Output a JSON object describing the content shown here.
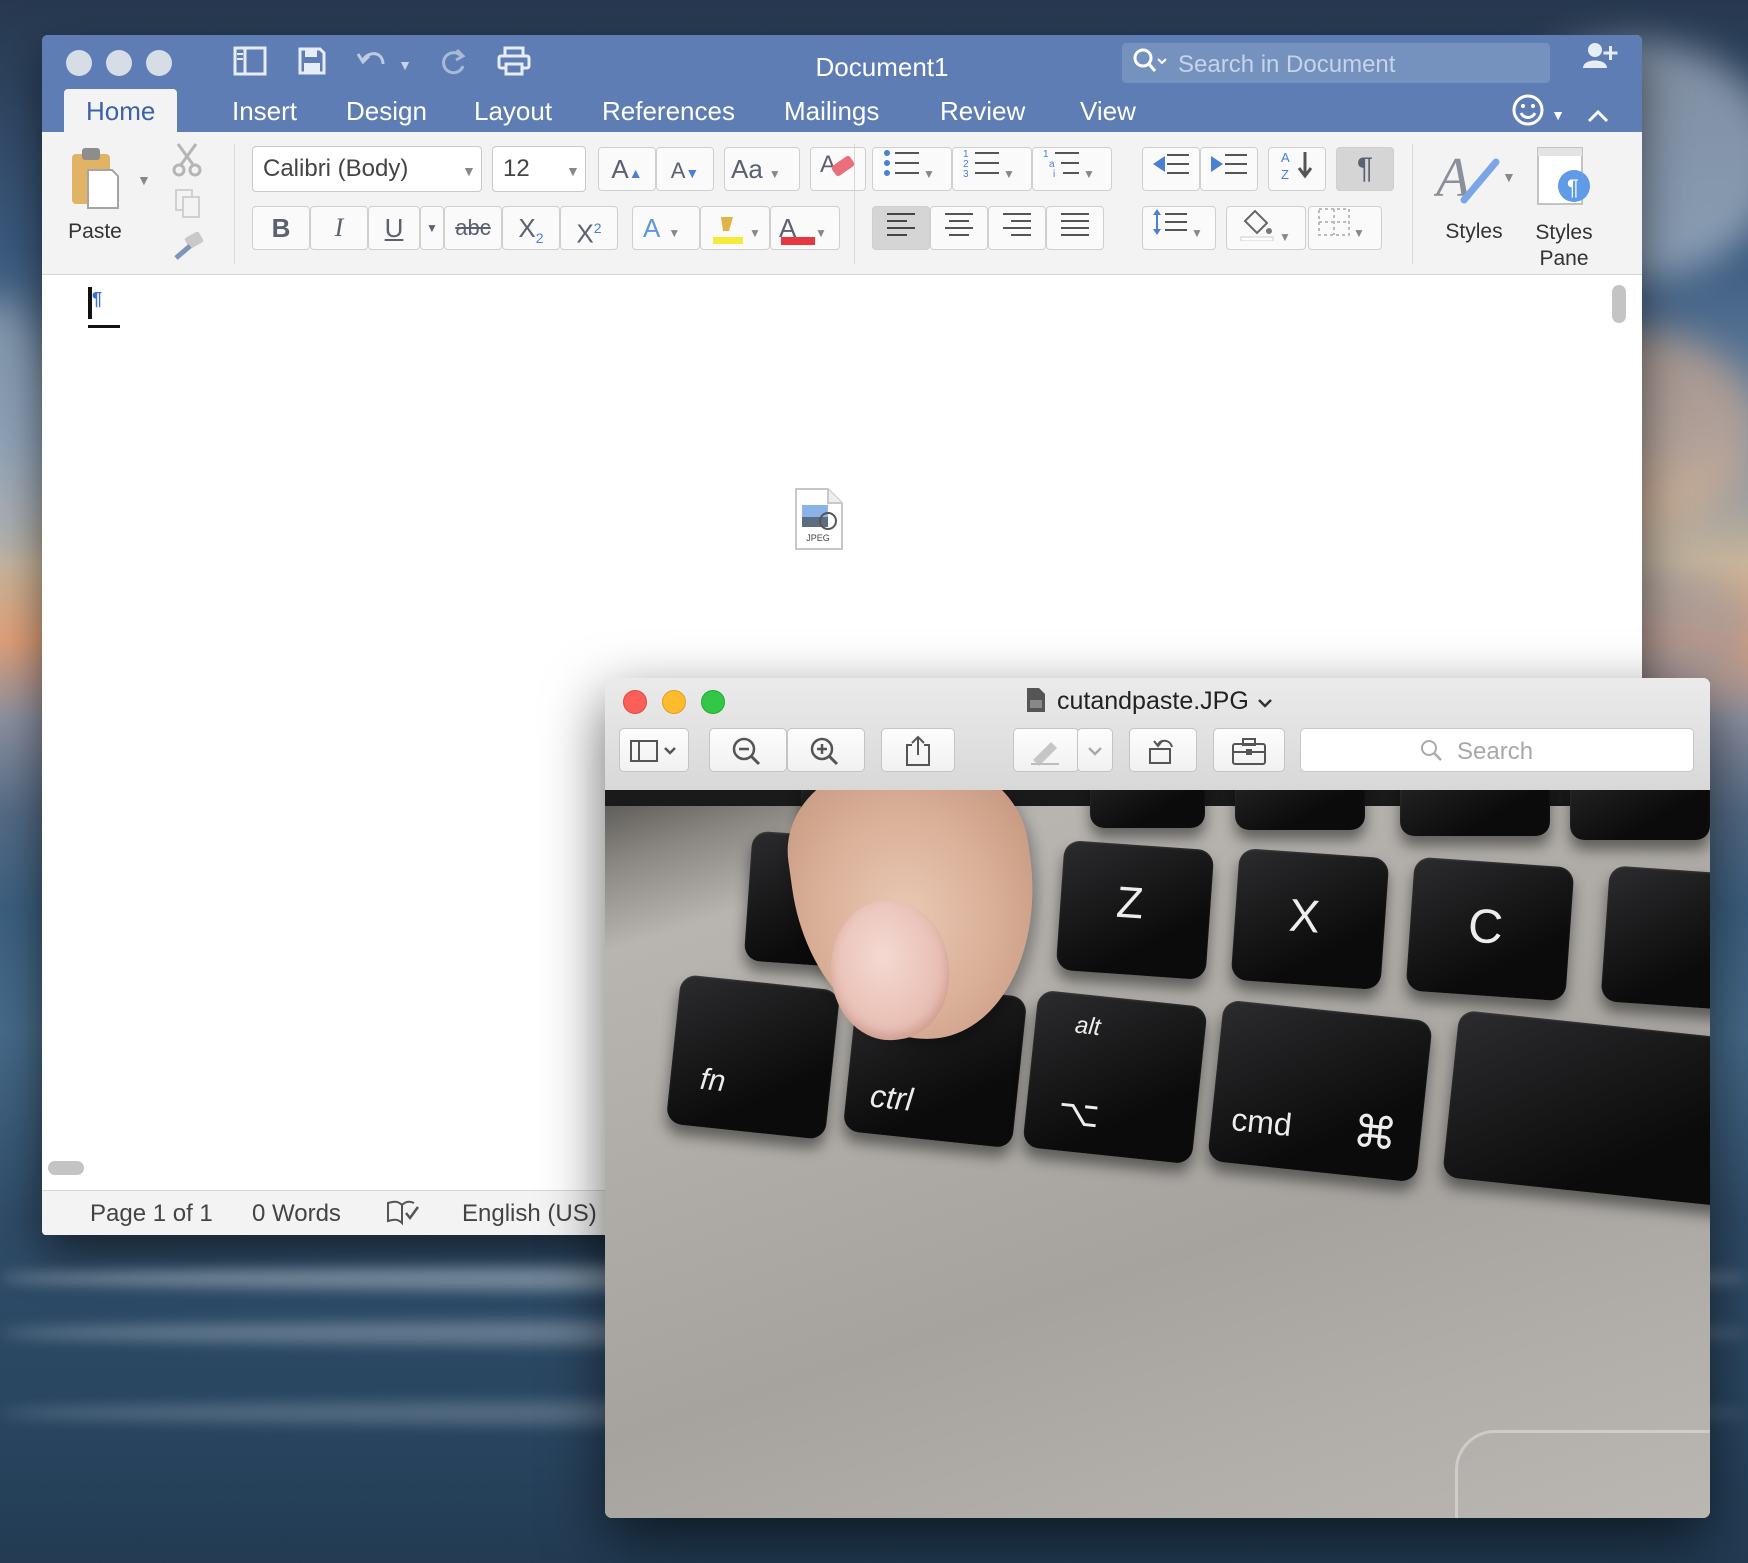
{
  "word": {
    "window_title": "Document1",
    "search_placeholder": "Search in Document",
    "tabs": [
      "Home",
      "Insert",
      "Design",
      "Layout",
      "References",
      "Mailings",
      "Review",
      "View"
    ],
    "active_tab": "Home",
    "font_name": "Calibri (Body)",
    "font_size": "12",
    "paste_label": "Paste",
    "styles_label": "Styles",
    "styles_pane_label_1": "Styles",
    "styles_pane_label_2": "Pane",
    "bold": "B",
    "italic": "I",
    "underline": "U",
    "strikethrough": "abc",
    "subscript": "X",
    "superscript": "X",
    "font_color_letter": "A",
    "grow_font": "A",
    "shrink_font": "A",
    "change_case": "Aa",
    "text_effects": "A",
    "pilcrow": "¶",
    "embedded_file_label": "JPEG",
    "status": {
      "page": "Page 1 of 1",
      "words": "0 Words",
      "language": "English (US)"
    }
  },
  "preview": {
    "file_name": "cutandpaste.JPG",
    "search_placeholder": "Search",
    "photo_keys": {
      "z": "Z",
      "x": "X",
      "c": "C",
      "fn": "fn",
      "ctrl": "ctrl",
      "alt": "alt",
      "option_symbol": "⌥",
      "cmd": "cmd",
      "cmd_symbol": "⌘",
      "shift_symbol": "⇧"
    }
  },
  "colors": {
    "word_titlebar": "#5d7db4",
    "word_active_tab_text": "#3d62a8",
    "close": "#fc5f57",
    "minimize": "#fdbc2e",
    "zoom": "#33c748"
  }
}
